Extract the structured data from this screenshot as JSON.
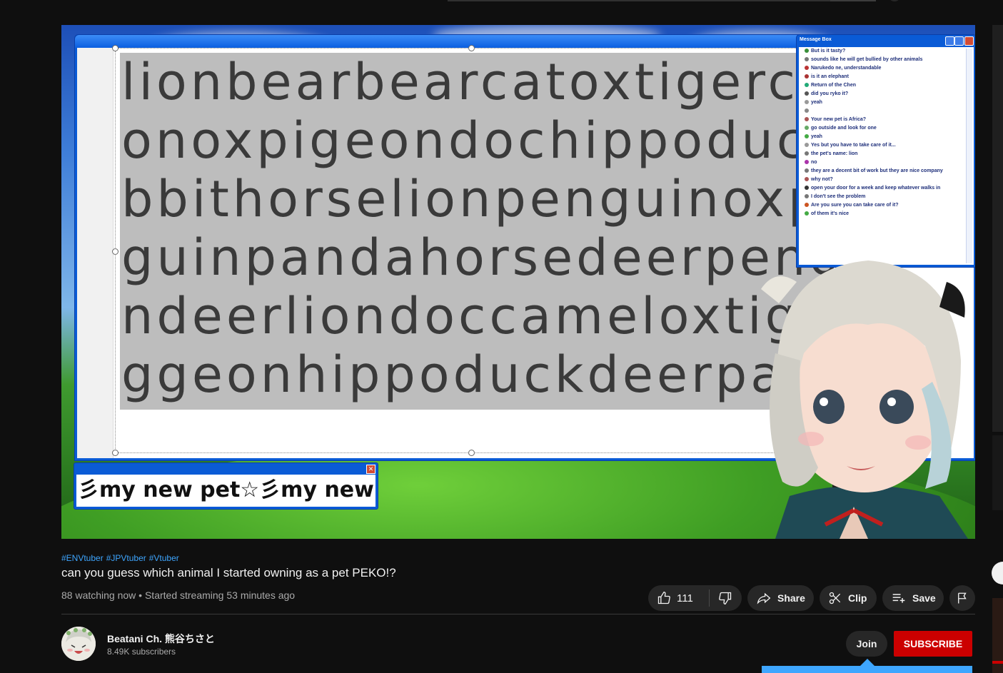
{
  "video": {
    "chat_window_title": "Message Box",
    "big_text_lines": [
      "lionbearbearcatoxtigercatli",
      "onoxpigeondochippoduckra",
      "bbithorselionpenguinoxpen",
      "guinpandahorsedeerpengu",
      "ndeerliondoccameloxtiger",
      "ggeonhippoduckdeerpanc"
    ],
    "ticker_text": "彡my new pet☆彡my new pe",
    "chat_messages": [
      "But is it tasty?",
      "sounds like he will get bullied by other animals",
      "Narukedo ne, understandable",
      "is it an elephant",
      "Return of the Chen",
      "did you ryko it?",
      "yeah",
      "",
      "Your new pet is Africa?",
      "go outside and look for one",
      "yeah",
      "Yes but you have to take care of it...",
      "the pet's name: lion",
      "no",
      "they are a decent bit of work but they are nice company",
      "why not?",
      "open your door for a week and keep whatever walks in",
      "I don't see the problem",
      "Are you sure you can take care of it?",
      "of them it's nice"
    ]
  },
  "info": {
    "hashtags": [
      "#ENVtuber",
      "#JPVtuber",
      "#Vtuber"
    ],
    "title": "can you guess which animal I started owning as a pet PEKO!?",
    "meta": "88 watching now • Started streaming 53 minutes ago"
  },
  "actions": {
    "like_count": "111",
    "share_label": "Share",
    "clip_label": "Clip",
    "save_label": "Save"
  },
  "channel": {
    "name": "Beatani Ch. 熊谷ちさと",
    "subscribers": "8.49K subscribers",
    "join_label": "Join",
    "subscribe_label": "SUBSCRIBE"
  },
  "colors": {
    "background": "#0f0f0f",
    "subscribe_red": "#cc0000",
    "link_blue": "#3ea6ff"
  }
}
